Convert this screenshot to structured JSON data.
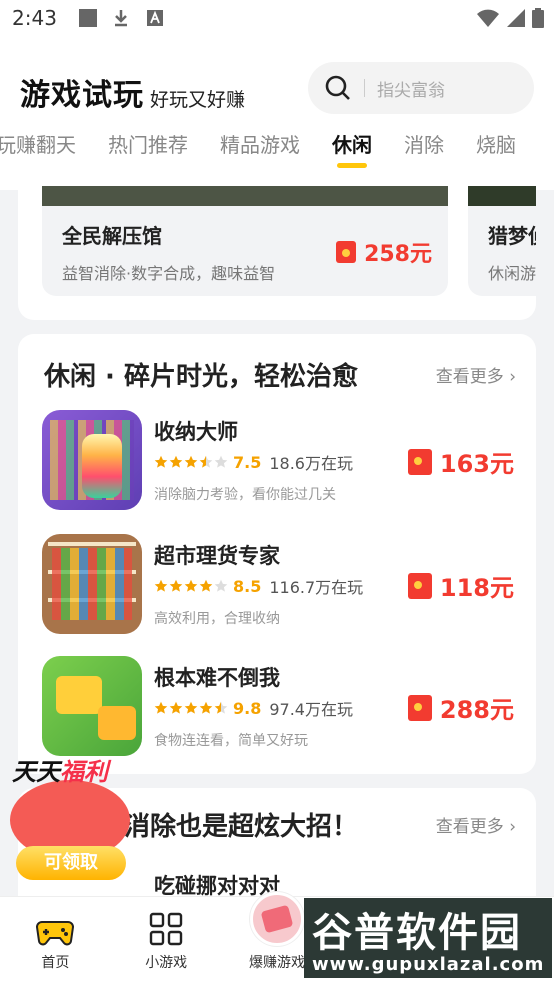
{
  "status_bar": {
    "time": "2:43"
  },
  "header": {
    "title": "游戏试玩",
    "subtitle": "好玩又好赚",
    "search_placeholder": "指尖富翁"
  },
  "tabs": [
    {
      "label": "玩赚翻天",
      "active": false
    },
    {
      "label": "热门推荐",
      "active": false
    },
    {
      "label": "精品游戏",
      "active": false
    },
    {
      "label": "休闲",
      "active": true
    },
    {
      "label": "消除",
      "active": false
    },
    {
      "label": "烧脑",
      "active": false
    }
  ],
  "promo_cards": [
    {
      "title": "全民解压馆",
      "desc": "益智消除·数字合成，趣味益智",
      "reward": "258元"
    },
    {
      "title": "猎梦侦",
      "desc": "休闲游"
    }
  ],
  "section_casual": {
    "title": "休闲 · 碎片时光，轻松治愈",
    "more": "查看更多",
    "games": [
      {
        "name": "收纳大师",
        "rating": "7.5",
        "stars": 3.5,
        "players": "18.6万在玩",
        "desc": "消除脑力考验，看你能过几关",
        "reward": "163元"
      },
      {
        "name": "超市理货专家",
        "rating": "8.5",
        "stars": 4,
        "players": "116.7万在玩",
        "desc": "高效利用，合理收纳",
        "reward": "118元"
      },
      {
        "name": "根本难不倒我",
        "rating": "9.8",
        "stars": 4.5,
        "players": "97.4万在玩",
        "desc": "食物连连看，简单又好玩",
        "reward": "288元"
      }
    ]
  },
  "section_elim": {
    "title": "消除也是超炫大招！",
    "more": "查看更多",
    "first_game": "吃碰挪对对对"
  },
  "floating_promo": {
    "title_a": "天天",
    "title_b": "福利",
    "button": "可领取"
  },
  "bottom_nav": [
    {
      "label": "首页",
      "icon": "gamepad-icon",
      "active": true
    },
    {
      "label": "小游戏",
      "icon": "grid-icon",
      "active": false
    },
    {
      "label": "爆赚游戏",
      "icon": "money-icon",
      "active": false
    }
  ],
  "watermark": {
    "text": "谷普软件园",
    "url": "www.gupuxlazal.com"
  },
  "colors": {
    "accent": "#ffc60b",
    "reward": "#f23b30",
    "star": "#f5a200"
  }
}
